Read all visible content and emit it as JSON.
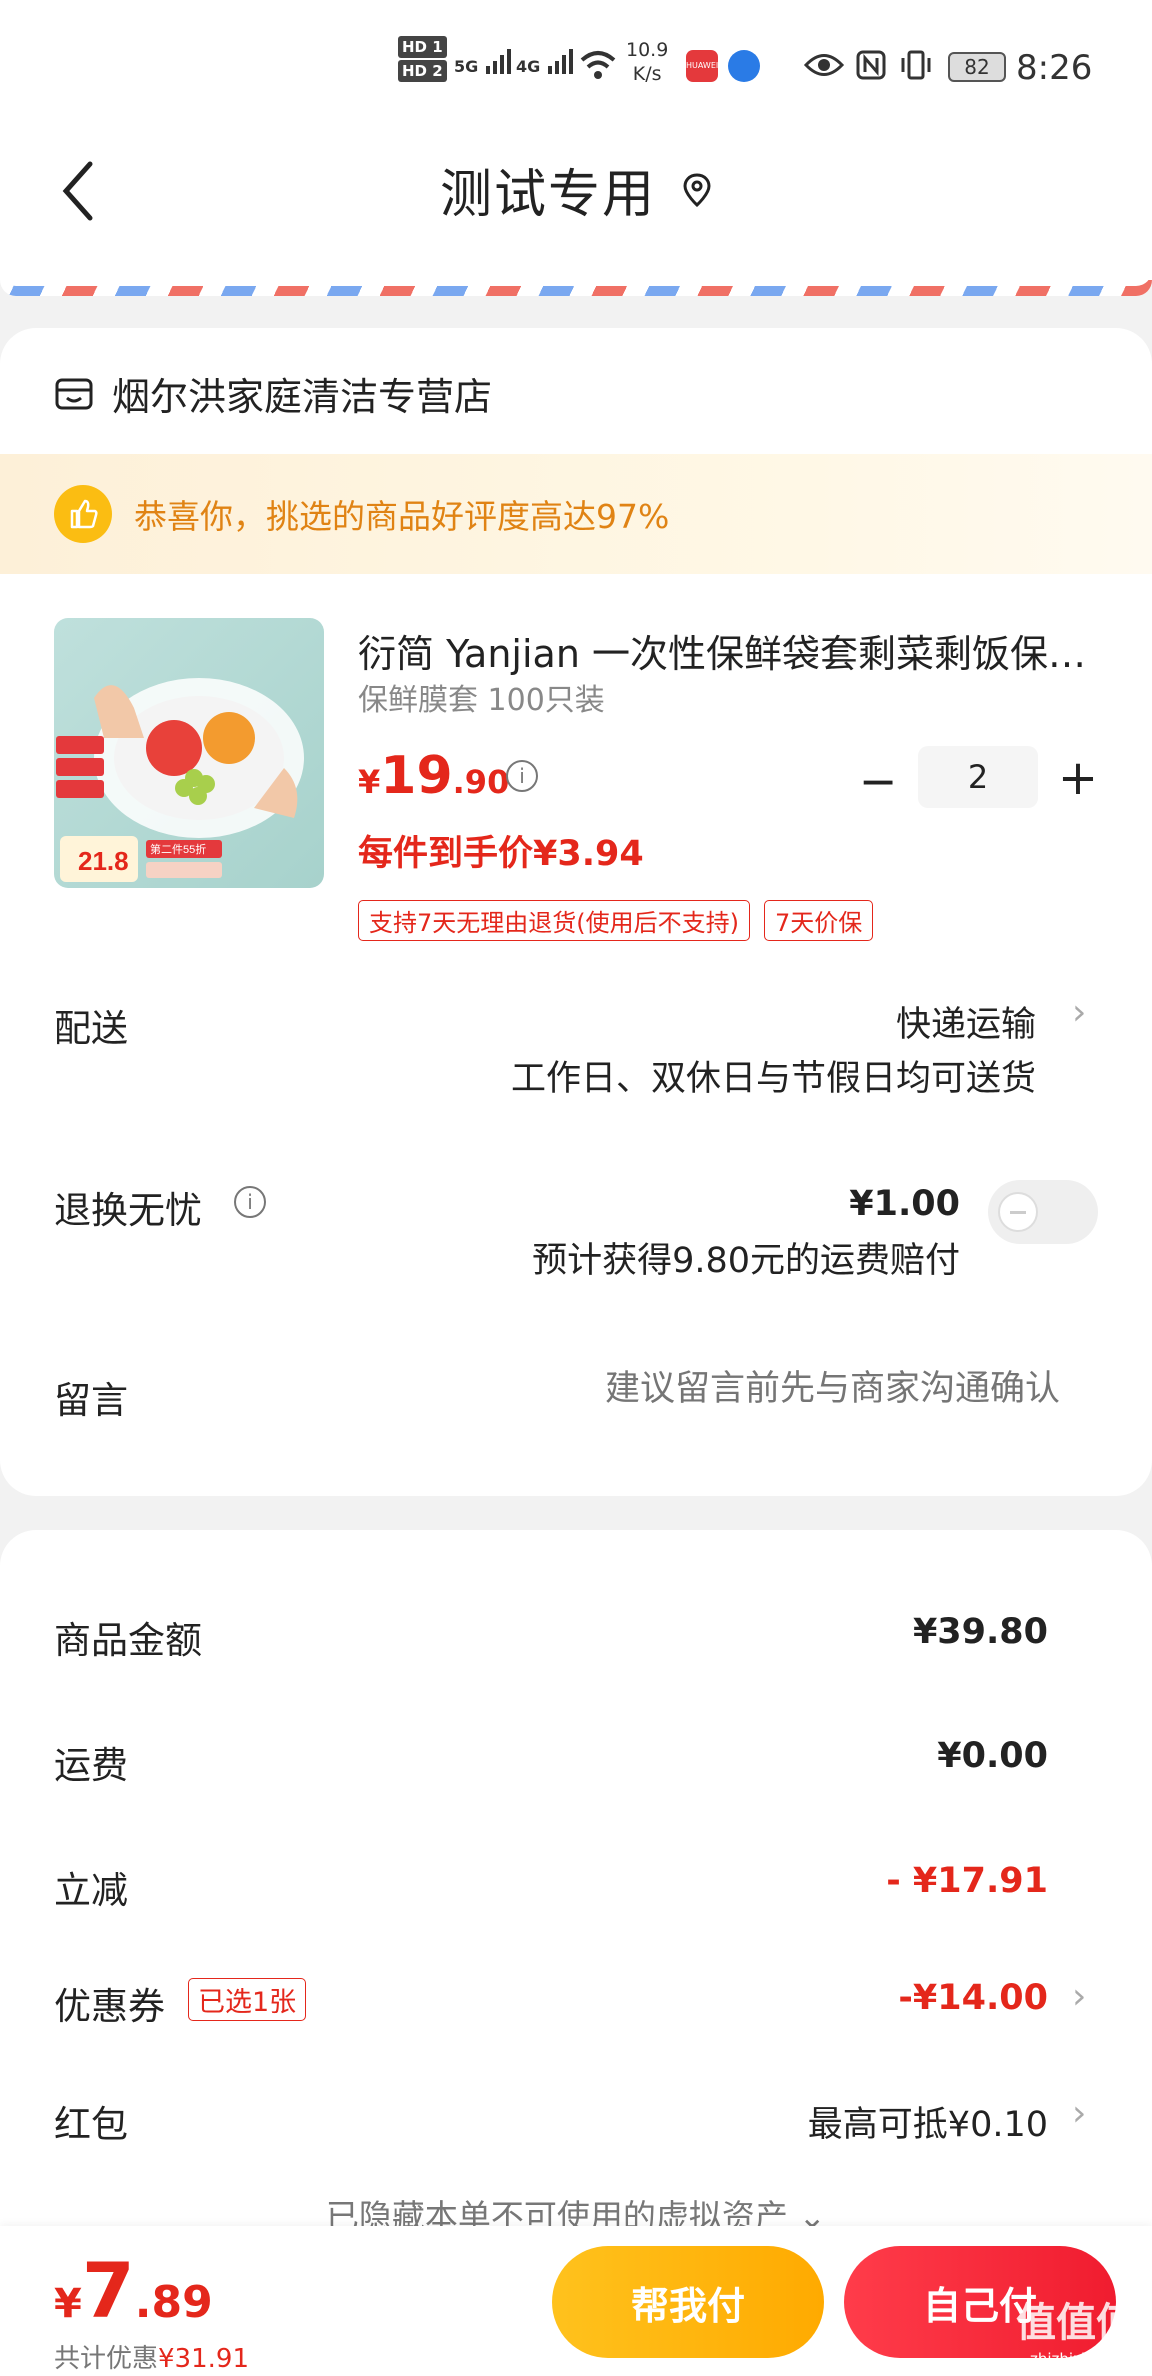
{
  "status_bar": {
    "hd1": "HD 1",
    "hd2": "HD 2",
    "sig1": "5G",
    "sig2": "4G",
    "speed_value": "10.9",
    "speed_unit": "K/s",
    "battery": "82",
    "time": "8:26"
  },
  "header": {
    "title": "测试专用"
  },
  "store": {
    "name": "烟尔洪家庭清洁专营店"
  },
  "banner": {
    "text": "恭喜你，挑选的商品好评度高达97%"
  },
  "product": {
    "title": "衍简 Yanjian 一次性保鲜袋套剩菜剩饭保鲜膜套",
    "spec": "保鲜膜套 100只装",
    "price_symbol": "¥",
    "price_int": "19",
    "price_dec": ".90",
    "quantity": "2",
    "each_price": "每件到手价¥3.94",
    "tags": [
      "支持7天无理由退货(使用后不支持)",
      "7天价保"
    ],
    "image_overlay": {
      "price": "21.8",
      "promo": "第二件55折"
    }
  },
  "delivery": {
    "label": "配送",
    "method": "快递运输",
    "desc": "工作日、双休日与节假日均可送货"
  },
  "return_service": {
    "label": "退换无忧",
    "price": "¥1.00",
    "desc": "预计获得9.80元的运费赔付",
    "enabled": false
  },
  "message": {
    "label": "留言",
    "placeholder": "建议留言前先与商家沟通确认"
  },
  "summary": {
    "goods_label": "商品金额",
    "goods_value": "¥39.80",
    "shipping_label": "运费",
    "shipping_value": "¥0.00",
    "discount_label": "立减",
    "discount_value": "- ¥17.91",
    "coupon_label": "优惠券",
    "coupon_tag": "已选1张",
    "coupon_value": "-¥14.00",
    "redpack_label": "红包",
    "redpack_value": "最高可抵¥0.10",
    "hidden_note": "已隐藏本单不可使用的虚拟资产 ⌄"
  },
  "bottom": {
    "total_symbol": "¥",
    "total_int": "7",
    "total_dec": ".89",
    "saved_label": "共计优惠",
    "saved_amount": "¥31.91",
    "help_pay": "帮我付",
    "self_pay": "自己付"
  },
  "watermark": {
    "text": "值值值",
    "sub": "zhizhizhi.com"
  },
  "colors": {
    "price_red": "#e4271b",
    "help_btn": "#ffb400",
    "pay_btn": "#f5222d",
    "banner_text": "#e08314"
  }
}
